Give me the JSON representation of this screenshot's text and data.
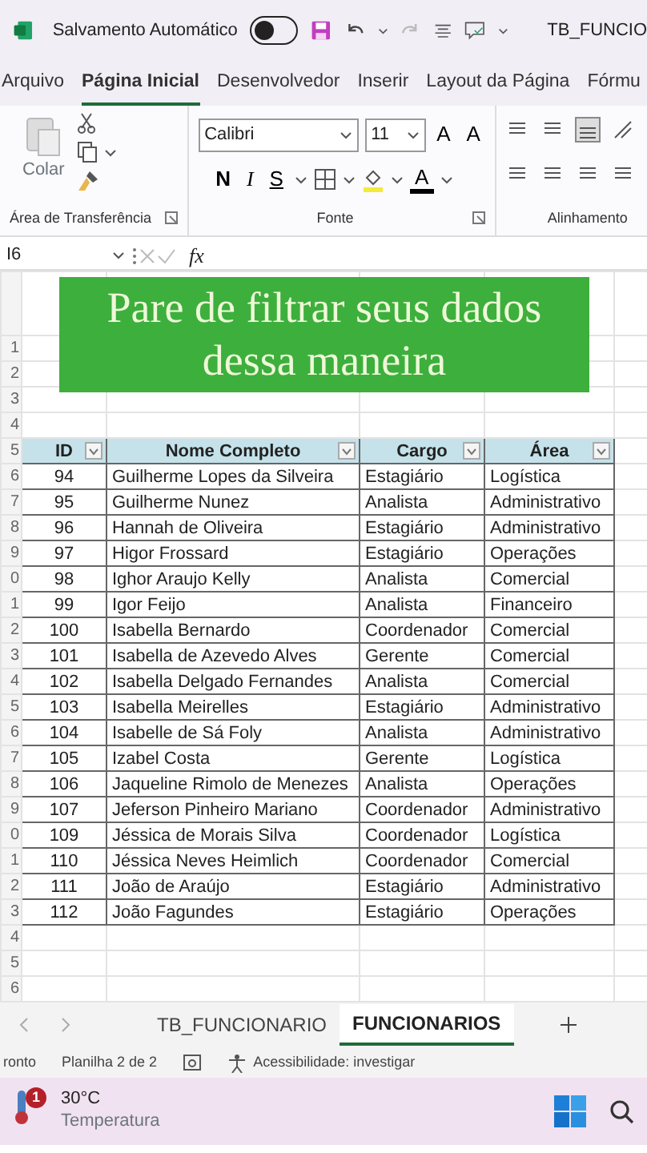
{
  "title_bar": {
    "autosave_label": "Salvamento Automático",
    "autosave_on": false,
    "document_title": "TB_FUNCIO"
  },
  "ribbon_tabs": [
    {
      "label": "Arquivo",
      "selected": false
    },
    {
      "label": "Página Inicial",
      "selected": true
    },
    {
      "label": "Desenvolvedor",
      "selected": false
    },
    {
      "label": "Inserir",
      "selected": false
    },
    {
      "label": "Layout da Página",
      "selected": false
    },
    {
      "label": "Fórmu",
      "selected": false
    }
  ],
  "ribbon": {
    "paste_label": "Colar",
    "font_name": "Calibri",
    "font_size": "11",
    "grow_font": "A",
    "shrink_font": "A",
    "bold": "N",
    "italic": "I",
    "underline": "S",
    "font_color": "A",
    "groups": [
      "Área de Transferência",
      "Fonte",
      "Alinhamento"
    ]
  },
  "formula_bar": {
    "name_box": "I6",
    "function_label": "fx"
  },
  "caption": "Pare de filtrar seus dados\ndessa maneira",
  "sheet": {
    "rows_before": [
      "1",
      "2",
      "3",
      "4"
    ],
    "header_row": "5",
    "columns": [
      {
        "label": "ID"
      },
      {
        "label": "Nome Completo"
      },
      {
        "label": "Cargo"
      },
      {
        "label": "Área"
      }
    ],
    "rows": [
      {
        "row": "6",
        "cells": [
          "94",
          "Guilherme Lopes da Silveira",
          "Estagiário",
          "Logística"
        ]
      },
      {
        "row": "7",
        "cells": [
          "95",
          "Guilherme Nunez",
          "Analista",
          "Administrativo"
        ]
      },
      {
        "row": "8",
        "cells": [
          "96",
          "Hannah de Oliveira",
          "Estagiário",
          "Administrativo"
        ]
      },
      {
        "row": "9",
        "cells": [
          "97",
          "Higor Frossard",
          "Estagiário",
          "Operações"
        ]
      },
      {
        "row": "0",
        "cells": [
          "98",
          "Ighor Araujo Kelly",
          "Analista",
          "Comercial"
        ]
      },
      {
        "row": "1",
        "cells": [
          "99",
          "Igor Feijo",
          "Analista",
          "Financeiro"
        ]
      },
      {
        "row": "2",
        "cells": [
          "100",
          "Isabella Bernardo",
          "Coordenador",
          "Comercial"
        ]
      },
      {
        "row": "3",
        "cells": [
          "101",
          "Isabella de Azevedo Alves",
          "Gerente",
          "Comercial"
        ]
      },
      {
        "row": "4",
        "cells": [
          "102",
          "Isabella Delgado Fernandes",
          "Analista",
          "Comercial"
        ]
      },
      {
        "row": "5",
        "cells": [
          "103",
          "Isabella Meirelles",
          "Estagiário",
          "Administrativo"
        ]
      },
      {
        "row": "6",
        "cells": [
          "104",
          "Isabelle de Sá Foly",
          "Analista",
          "Administrativo"
        ]
      },
      {
        "row": "7",
        "cells": [
          "105",
          "Izabel Costa",
          "Gerente",
          "Logística"
        ]
      },
      {
        "row": "8",
        "cells": [
          "106",
          "Jaqueline Rimolo de Menezes",
          "Analista",
          "Operações"
        ]
      },
      {
        "row": "9",
        "cells": [
          "107",
          "Jeferson Pinheiro Mariano",
          "Coordenador",
          "Administrativo"
        ]
      },
      {
        "row": "0",
        "cells": [
          "109",
          "Jéssica de Morais Silva",
          "Coordenador",
          "Logística"
        ]
      },
      {
        "row": "1",
        "cells": [
          "110",
          "Jéssica Neves Heimlich",
          "Coordenador",
          "Comercial"
        ]
      },
      {
        "row": "2",
        "cells": [
          "111",
          "João de Araújo",
          "Estagiário",
          "Administrativo"
        ]
      },
      {
        "row": "3",
        "cells": [
          "112",
          "João Fagundes",
          "Estagiário",
          "Operações"
        ]
      }
    ],
    "rows_after": [
      "4",
      "5",
      "6"
    ]
  },
  "sheet_tabs": [
    {
      "label": "TB_FUNCIONARIO",
      "selected": false
    },
    {
      "label": "FUNCIONARIOS",
      "selected": true
    }
  ],
  "status_bar": {
    "ready": "ronto",
    "sheet_info": "Planilha 2 de 2",
    "accessibility": "Acessibilidade: investigar"
  },
  "taskbar": {
    "weather_badge": "1",
    "temperature": "30°C",
    "weather_label": "Temperatura"
  }
}
